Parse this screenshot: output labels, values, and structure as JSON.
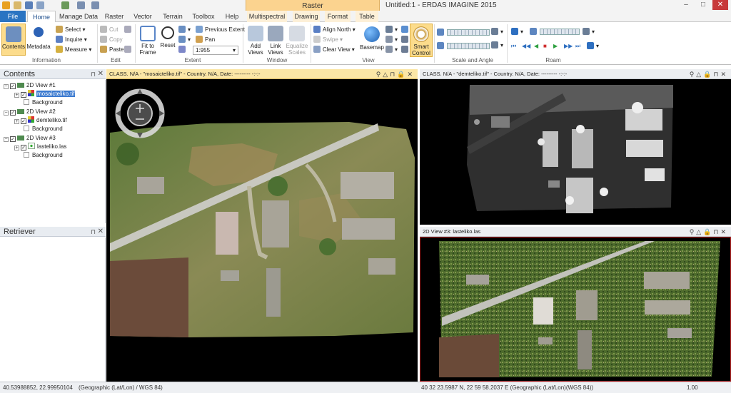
{
  "title_bar": {
    "app_title": "Untitled:1 - ERDAS IMAGINE 2015",
    "context_group": "Raster",
    "minimize": "–",
    "maximize": "□",
    "close": "✕"
  },
  "tabs": [
    "File",
    "Home",
    "Manage Data",
    "Raster",
    "Vector",
    "Terrain",
    "Toolbox",
    "Help",
    "Multispectral",
    "Drawing",
    "Format",
    "Table"
  ],
  "ribbon": {
    "information": {
      "label": "Information",
      "contents": "Contents",
      "metadata": "Metadata"
    },
    "select": "Select",
    "inquire": "Inquire",
    "measure": "Measure",
    "edit": {
      "label": "Edit",
      "cut": "Cut",
      "copy": "Copy",
      "paste": "Paste"
    },
    "extent": {
      "label": "Extent",
      "fit_to_frame_1": "Fit to",
      "fit_to_frame_2": "Frame",
      "reset": "Reset",
      "previous_extent": "Previous Extent",
      "pan": "Pan",
      "scale_value": "1:955"
    },
    "window": {
      "label": "Window",
      "add_views_1": "Add",
      "add_views_2": "Views",
      "link_views_1": "Link",
      "link_views_2": "Views",
      "equalize_1": "Equalize",
      "equalize_2": "Scales"
    },
    "view": {
      "label": "View",
      "align_north": "Align North",
      "swipe": "Swipe",
      "clear_view": "Clear View",
      "basemap": "Basemap",
      "smart_control_1": "Smart",
      "smart_control_2": "Control"
    },
    "scale_angle": {
      "label": "Scale and Angle"
    },
    "roam": {
      "label": "Roam"
    }
  },
  "contents_panel": {
    "title": "Contents",
    "views": [
      {
        "name": "2D View #1",
        "layer": "mosaicteliko.tif",
        "background": "Background"
      },
      {
        "name": "2D View #2",
        "layer": "demteliko.tif",
        "background": "Background"
      },
      {
        "name": "2D View #3",
        "layer": "lasteliko.las",
        "background": "Background"
      }
    ]
  },
  "retriever_panel": {
    "title": "Retriever"
  },
  "view1": {
    "header": "CLASS. N/A - \"mosaicteliko.tif\" - Country. N/A, Date: --------- -:-:-"
  },
  "view2": {
    "header": "CLASS. N/A - \"demteliko.tif\" - Country. N/A, Date: --------- -:-:-"
  },
  "view3": {
    "header": "2D View #3: lasteliko.las"
  },
  "status_bar": {
    "left_coords": "40.53988852, 22.99950104",
    "left_system": "(Geographic (Lat/Lon) / WGS 84)",
    "right_coords": "40 32 23.5987 N,  22 59 58.2037 E (Geographic (Lat/Lon)(WGS 84))",
    "right_value": "1.00"
  },
  "colors": {
    "file_tab": "#2a74c2",
    "context_group": "#fbd38f",
    "active_view_header": "#fbe6a6",
    "selection": "#3b7ad0",
    "close_button": "#c7393a"
  }
}
